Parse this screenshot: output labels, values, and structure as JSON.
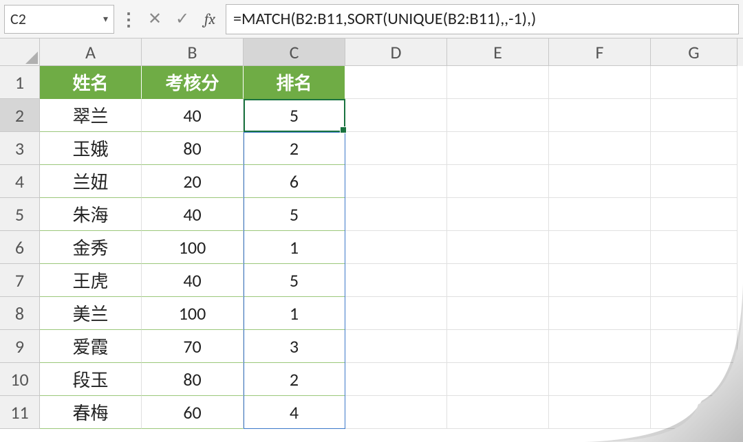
{
  "name_box": "C2",
  "formula": "=MATCH(B2:B11,SORT(UNIQUE(B2:B11),,-1),)",
  "col_letters": [
    "A",
    "B",
    "C",
    "D",
    "E",
    "F",
    "G"
  ],
  "row_numbers": [
    "1",
    "2",
    "3",
    "4",
    "5",
    "6",
    "7",
    "8",
    "9",
    "10",
    "11"
  ],
  "table": {
    "headers": {
      "A": "姓名",
      "B": "考核分",
      "C": "排名"
    },
    "rows": [
      {
        "A": "翠兰",
        "B": "40",
        "C": "5"
      },
      {
        "A": "玉娥",
        "B": "80",
        "C": "2"
      },
      {
        "A": "兰妞",
        "B": "20",
        "C": "6"
      },
      {
        "A": "朱海",
        "B": "40",
        "C": "5"
      },
      {
        "A": "金秀",
        "B": "100",
        "C": "1"
      },
      {
        "A": "王虎",
        "B": "40",
        "C": "5"
      },
      {
        "A": "美兰",
        "B": "100",
        "C": "1"
      },
      {
        "A": "爱霞",
        "B": "70",
        "C": "3"
      },
      {
        "A": "段玉",
        "B": "80",
        "C": "2"
      },
      {
        "A": "春梅",
        "B": "60",
        "C": "4"
      }
    ]
  },
  "icons": {
    "cancel": "✕",
    "enter": "✓",
    "fx": "fx"
  },
  "chart_data": {
    "type": "table",
    "title": "",
    "columns": [
      "姓名",
      "考核分",
      "排名"
    ],
    "rows": [
      [
        "翠兰",
        40,
        5
      ],
      [
        "玉娥",
        80,
        2
      ],
      [
        "兰妞",
        20,
        6
      ],
      [
        "朱海",
        40,
        5
      ],
      [
        "金秀",
        100,
        1
      ],
      [
        "王虎",
        40,
        5
      ],
      [
        "美兰",
        100,
        1
      ],
      [
        "爱霞",
        70,
        3
      ],
      [
        "段玉",
        80,
        2
      ],
      [
        "春梅",
        60,
        4
      ]
    ]
  }
}
